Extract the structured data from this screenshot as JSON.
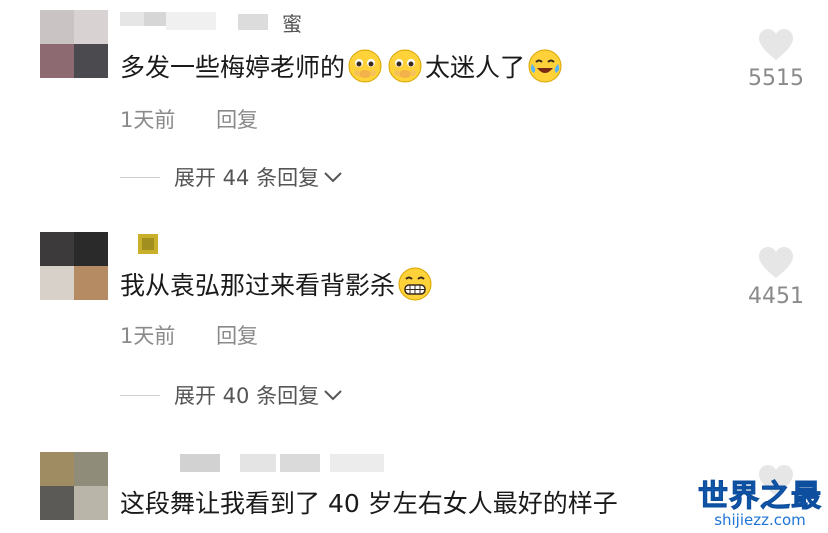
{
  "comments": [
    {
      "name_suffix": "蜜",
      "text_before": "多发一些梅婷老师的",
      "emojis_mid": [
        "pleading-face-icon",
        "pleading-face-icon"
      ],
      "text_after": "太迷人了",
      "emoji_end": "crying-laughing-face-icon",
      "time": "1天前",
      "reply": "回复",
      "expand": "展开 44 条回复",
      "likes": "5515"
    },
    {
      "text_before": "我从袁弘那过来看背影杀",
      "emoji_end": "grinning-face-icon",
      "time": "1天前",
      "reply": "回复",
      "expand": "展开 40 条回复",
      "likes": "4451"
    },
    {
      "text_before": "这段舞让我看到了 40 岁左右女人最好的样子"
    }
  ],
  "watermark": {
    "title": "世界之最",
    "url": "shijiezz.com"
  },
  "colors": {
    "text": "#1a1a1a",
    "meta": "#8a8a8a",
    "watermark": "#1e74d8"
  }
}
